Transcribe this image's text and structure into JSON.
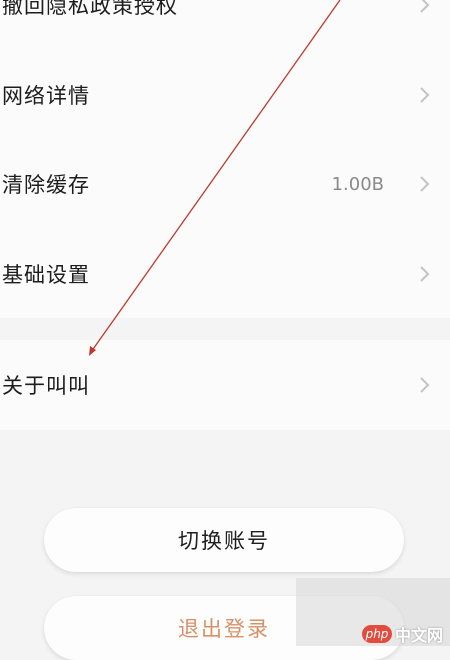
{
  "settings": {
    "items": [
      {
        "label": "撤回隐私政策授权",
        "value": ""
      },
      {
        "label": "网络详情",
        "value": ""
      },
      {
        "label": "清除缓存",
        "value": "1.00B"
      },
      {
        "label": "基础设置",
        "value": ""
      }
    ],
    "about": {
      "label": "关于叫叫"
    }
  },
  "buttons": {
    "switch_account": "切换账号",
    "logout": "退出登录"
  },
  "colors": {
    "logout_text": "#d59268",
    "annotation_arrow": "#c0392b"
  },
  "watermark": {
    "logo": "php",
    "site": "中文网"
  }
}
